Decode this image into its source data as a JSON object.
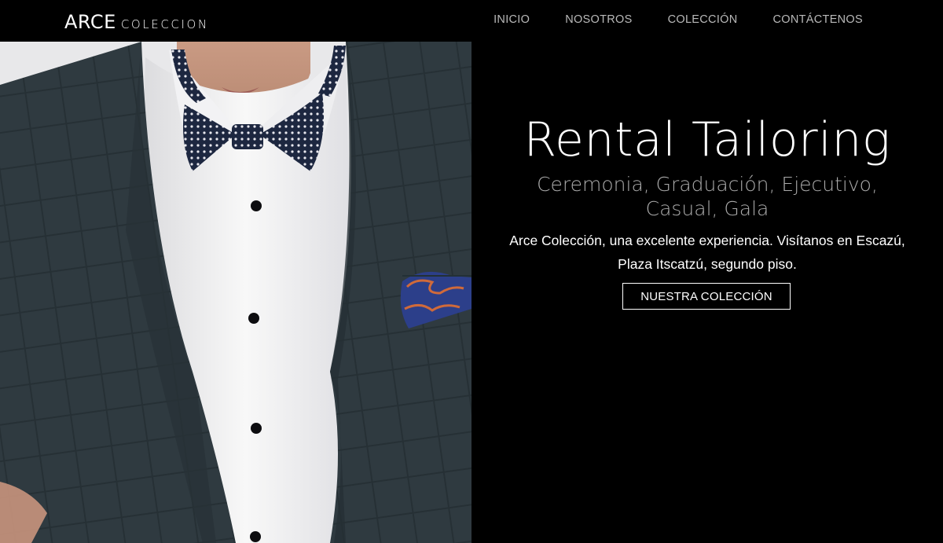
{
  "brand": {
    "name": "ARCE",
    "sub": "COLECCION"
  },
  "nav": {
    "items": [
      {
        "label": "INICIO"
      },
      {
        "label": "NOSOTROS"
      },
      {
        "label": "COLECCIÓN"
      },
      {
        "label": "CONTÁCTENOS"
      }
    ]
  },
  "hero": {
    "title": "Rental Tailoring",
    "subtitle": "Ceremonia, Graduación, Ejecutivo, Casual, Gala",
    "description": "Arce Colección, una excelente experiencia. Visítanos en Escazú, Plaza Itscatzú, segundo piso.",
    "cta_label": "NUESTRA COLECCIÓN"
  },
  "colors": {
    "background": "#000000",
    "nav_text": "#b9b9b9",
    "subtitle_text": "#aaaaaa",
    "suit": "#2f3a40",
    "shirt": "#f6f6f6"
  }
}
